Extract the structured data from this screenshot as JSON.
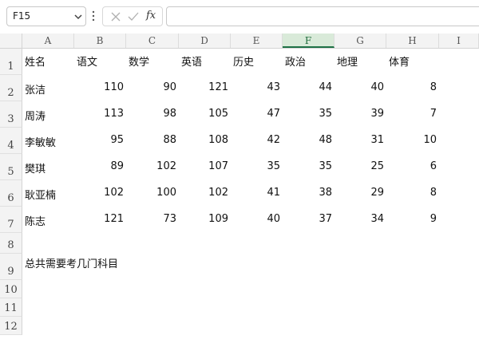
{
  "name_box": {
    "value": "F15"
  },
  "formula_bar": {
    "fx_label": "fx",
    "value": ""
  },
  "columns": [
    "A",
    "B",
    "C",
    "D",
    "E",
    "F",
    "G",
    "H",
    "I"
  ],
  "selected_column": "F",
  "rows": [
    "1",
    "2",
    "3",
    "4",
    "5",
    "6",
    "7",
    "8",
    "9",
    "10",
    "11",
    "12"
  ],
  "headers": [
    "姓名",
    "语文",
    "数学",
    "英语",
    "历史",
    "政治",
    "地理",
    "体育"
  ],
  "students": [
    {
      "name": "张洁",
      "scores": [
        "110",
        "90",
        "121",
        "43",
        "44",
        "40",
        "8"
      ]
    },
    {
      "name": "周涛",
      "scores": [
        "113",
        "98",
        "105",
        "47",
        "35",
        "39",
        "7"
      ]
    },
    {
      "name": "李敏敏",
      "scores": [
        "95",
        "88",
        "108",
        "42",
        "48",
        "31",
        "10"
      ]
    },
    {
      "name": "樊琪",
      "scores": [
        "89",
        "102",
        "107",
        "35",
        "35",
        "25",
        "6"
      ]
    },
    {
      "name": "耿亚楠",
      "scores": [
        "102",
        "100",
        "102",
        "41",
        "38",
        "29",
        "8"
      ]
    },
    {
      "name": "陈志",
      "scores": [
        "121",
        "73",
        "109",
        "40",
        "37",
        "34",
        "9"
      ]
    }
  ],
  "question": "总共需要考几门科目",
  "colors": {
    "selected_column_accent": "#1e7145"
  }
}
